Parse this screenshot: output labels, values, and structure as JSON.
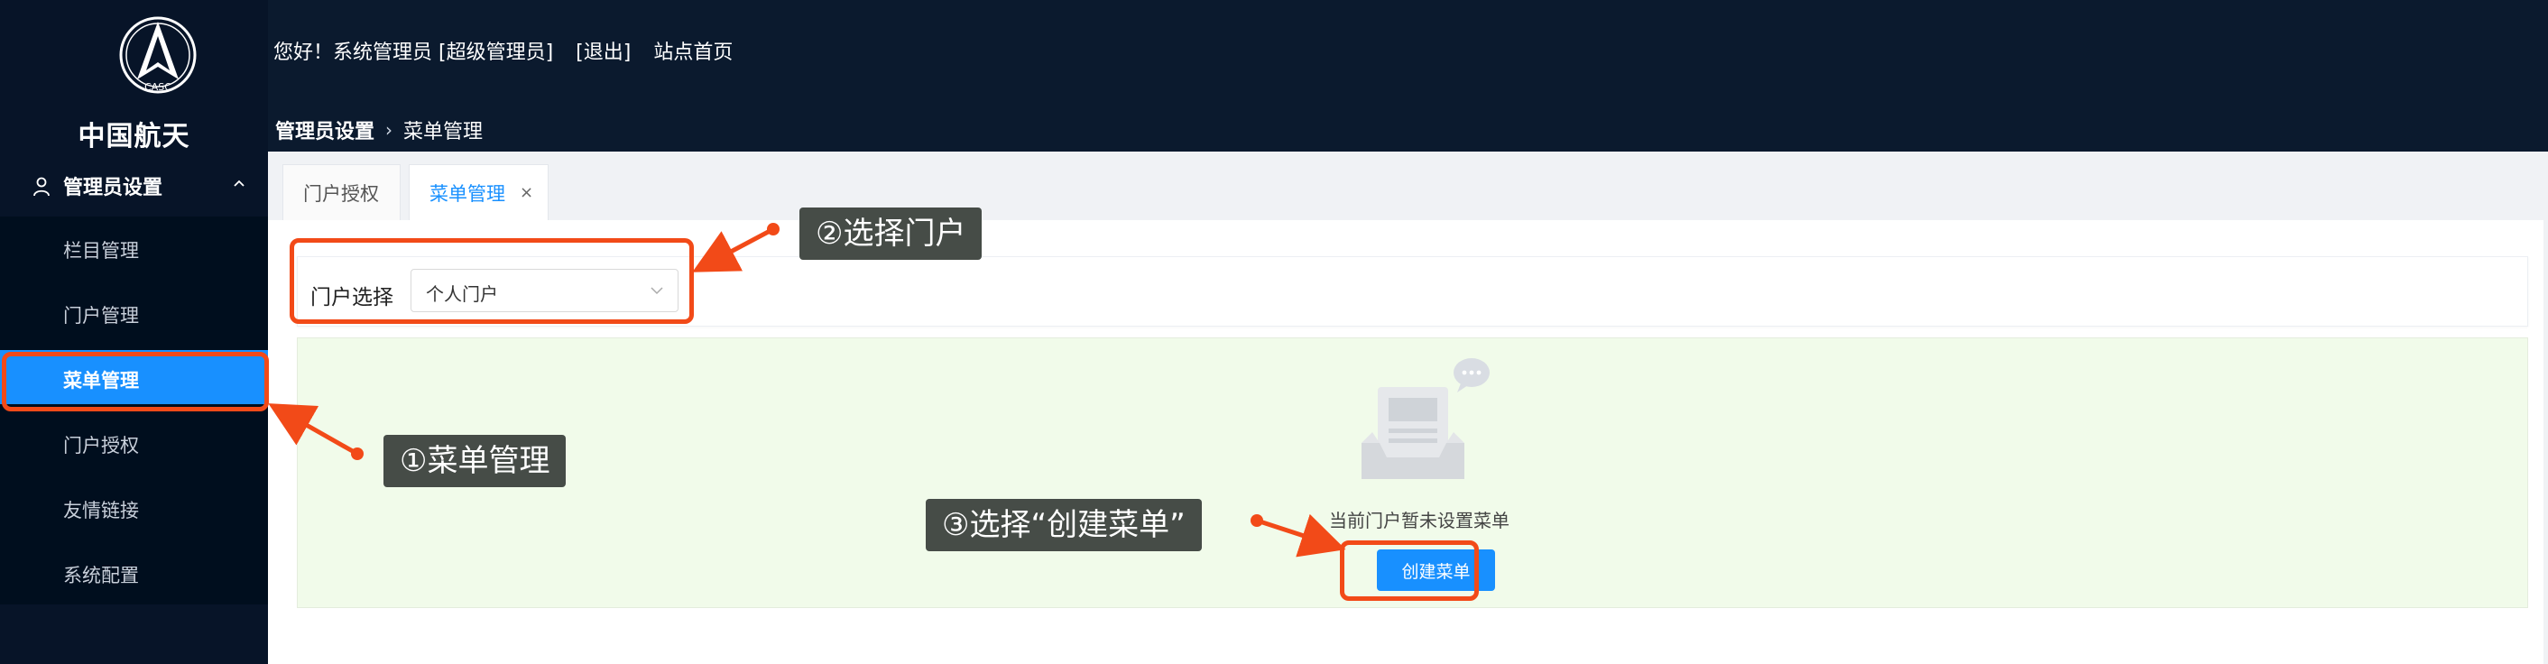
{
  "colors": {
    "header_bg": "#0b1a2e",
    "sidebar_bg": "#071428",
    "accent": "#1890ff",
    "annotation": "#f24a18",
    "callout_bg": "#464c47",
    "empty_bg": "#f1fbea"
  },
  "logo": {
    "emblem_text": "CASC",
    "title": "中国航天"
  },
  "header": {
    "greeting": "您好！系统管理员 [超级管理员]",
    "logout": "[退出]",
    "home": "站点首页"
  },
  "breadcrumb": {
    "parent": "管理员设置",
    "current": "菜单管理"
  },
  "sidebar": {
    "group_label": "管理员设置",
    "items": [
      {
        "label": "栏目管理",
        "active": false
      },
      {
        "label": "门户管理",
        "active": false
      },
      {
        "label": "菜单管理",
        "active": true
      },
      {
        "label": "门户授权",
        "active": false
      },
      {
        "label": "友情链接",
        "active": false
      },
      {
        "label": "系统配置",
        "active": false
      }
    ]
  },
  "tabs": [
    {
      "label": "门户授权",
      "active": false
    },
    {
      "label": "菜单管理",
      "active": true,
      "close": "×"
    }
  ],
  "filter": {
    "label": "门户选择",
    "selected": "个人门户"
  },
  "empty_state": {
    "message": "当前门户暂未设置菜单",
    "button": "创建菜单"
  },
  "callouts": {
    "step1": "①菜单管理",
    "step2": "②选择门户",
    "step3": "③选择“创建菜单”"
  }
}
